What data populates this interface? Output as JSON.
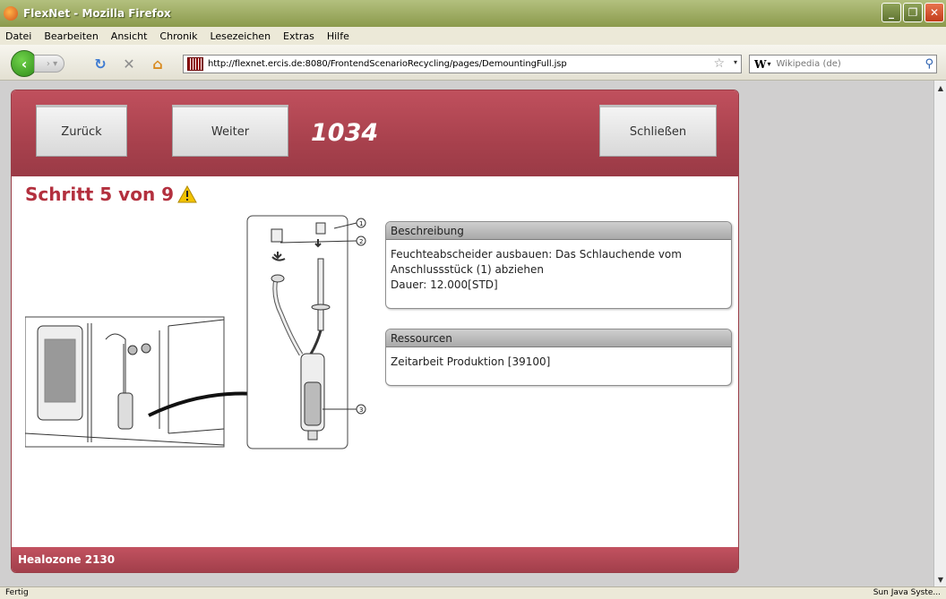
{
  "window": {
    "title": "FlexNet - Mozilla Firefox"
  },
  "menu": [
    "Datei",
    "Bearbeiten",
    "Ansicht",
    "Chronik",
    "Lesezeichen",
    "Extras",
    "Hilfe"
  ],
  "navigation": {
    "url": "http://flexnet.ercis.de:8080/FrontendScenarioRecycling/pages/DemountingFull.jsp",
    "search_placeholder": "Wikipedia (de)",
    "search_engine": "W"
  },
  "app": {
    "buttons": {
      "back": "Zurück",
      "next": "Weiter",
      "close": "Schließen"
    },
    "order_number": "1034",
    "step_title": "Schritt 5 von 9",
    "description": {
      "header": "Beschreibung",
      "text": "Feuchteabscheider ausbauen: Das Schlauchende vom Anschlussstück (1) abziehen",
      "duration": "Dauer: 12.000[STD]"
    },
    "resources": {
      "header": "Ressourcen",
      "text": "Zeitarbeit Produktion [39100]"
    },
    "footer": "Healozone 2130",
    "figure_callouts": [
      "1",
      "2",
      "3"
    ],
    "colors": {
      "header": "#a8414d",
      "title": "#b3303e",
      "warning": "#f2c200"
    }
  },
  "status": {
    "left": "Fertig",
    "right": "Sun Java Syste..."
  }
}
